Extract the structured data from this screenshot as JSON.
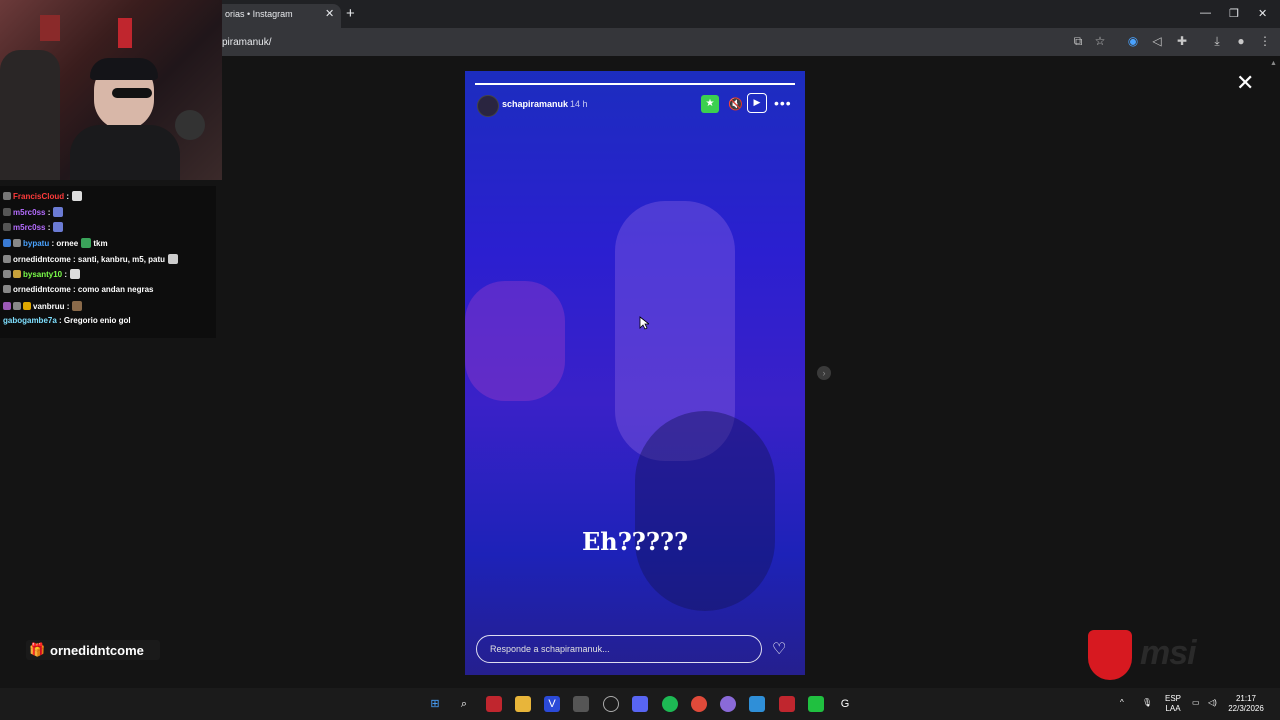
{
  "browser": {
    "tab_title": "orias • Instagram",
    "url": "piramanuk/",
    "tab_close": "✕",
    "new_tab": "+"
  },
  "chat": {
    "messages": [
      {
        "user": "FrancisCloud",
        "text": ":",
        "color": "#ff3b3b"
      },
      {
        "user": "m5rc0ss",
        "text": ":",
        "color": "#b56cff"
      },
      {
        "user": "m5rc0ss",
        "text": ":",
        "color": "#b56cff"
      },
      {
        "user": "bypatu",
        "text": ": ornee",
        "text2": "tkm",
        "color": "#4aa3ff"
      },
      {
        "user": "ornedidntcome",
        "text": ": santi, kanbru, m5, patu",
        "color": "#ffffff"
      },
      {
        "user": "bysanty10",
        "text": ":",
        "color": "#7cff4a"
      },
      {
        "user": "ornedidntcome",
        "text": ": como andan negras",
        "color": "#ffffff"
      },
      {
        "user": "vanbruu",
        "text": ":",
        "color": "#ffffff"
      },
      {
        "user": "gabogambe7a",
        "text": ": Gregorio enio gol",
        "color": "#7fe0ff"
      }
    ]
  },
  "story": {
    "username": "schapiramanuk",
    "time": "14 h",
    "caption": "Eh?????",
    "reply_placeholder": "Responde a schapiramanuk...",
    "star": "★",
    "mute": "🔇",
    "play": "▶",
    "more": "•••",
    "heart": "♡",
    "progress": 1.0
  },
  "overlay": {
    "close": "✕",
    "next": "›",
    "sub_name": "ornedidntcome",
    "brand": "msi"
  },
  "taskbar": {
    "lang_top": "ESP",
    "lang_bottom": "LAA",
    "time": "21:17",
    "date": "22/3/2026"
  },
  "colors": {
    "accent_green": "#3bd04f",
    "msi_red": "#d71920"
  }
}
